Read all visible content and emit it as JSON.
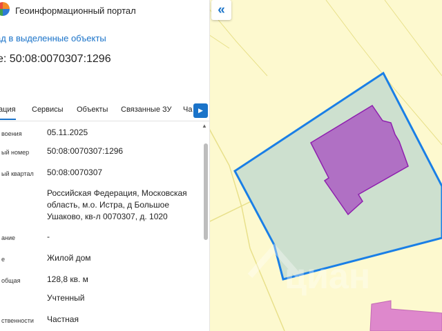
{
  "app": {
    "title": "Геоинформационный портал"
  },
  "panel": {
    "back_link": "ад в выделенные объекты",
    "object_title": "е: 50:08:0070307:1296"
  },
  "tabs": [
    {
      "label": "ация",
      "active": true
    },
    {
      "label": "Сервисы",
      "active": false
    },
    {
      "label": "Объекты",
      "active": false
    },
    {
      "label": "Связанные ЗУ",
      "active": false
    },
    {
      "label": "Ча",
      "active": false
    }
  ],
  "details": [
    {
      "label": "воения",
      "value": "05.11.2025"
    },
    {
      "label": "ый номер",
      "value": "50:08:0070307:1296"
    },
    {
      "label": "ый квартал",
      "value": "50:08:0070307"
    },
    {
      "label": "",
      "value": "Российская Федерация, Московская область, м.о. Истра, д Большое Ушаково, кв-л 0070307, д. 1020"
    },
    {
      "label": "ание",
      "value": "-"
    },
    {
      "label": "е",
      "value": "Жилой дом"
    },
    {
      "label": "общая",
      "value": "128,8 кв. м"
    },
    {
      "label": "",
      "value": "Учтенный"
    },
    {
      "label": "ственности",
      "value": "Частная"
    }
  ],
  "map": {
    "watermark": "циан",
    "colors": {
      "background": "#fdf9cf",
      "parcel_fill": "#cde0cf",
      "parcel_border": "#1a7fe6",
      "building_fill": "#b070c4",
      "building_border": "#8e1fae",
      "neighbor_fill": "#de88cc",
      "road": "#e8e08a"
    }
  },
  "colors": {
    "accent": "#1a73c9"
  },
  "icons": {
    "collapse": "double-chevron-left-icon",
    "tab_scroll": "chevron-right-icon"
  }
}
